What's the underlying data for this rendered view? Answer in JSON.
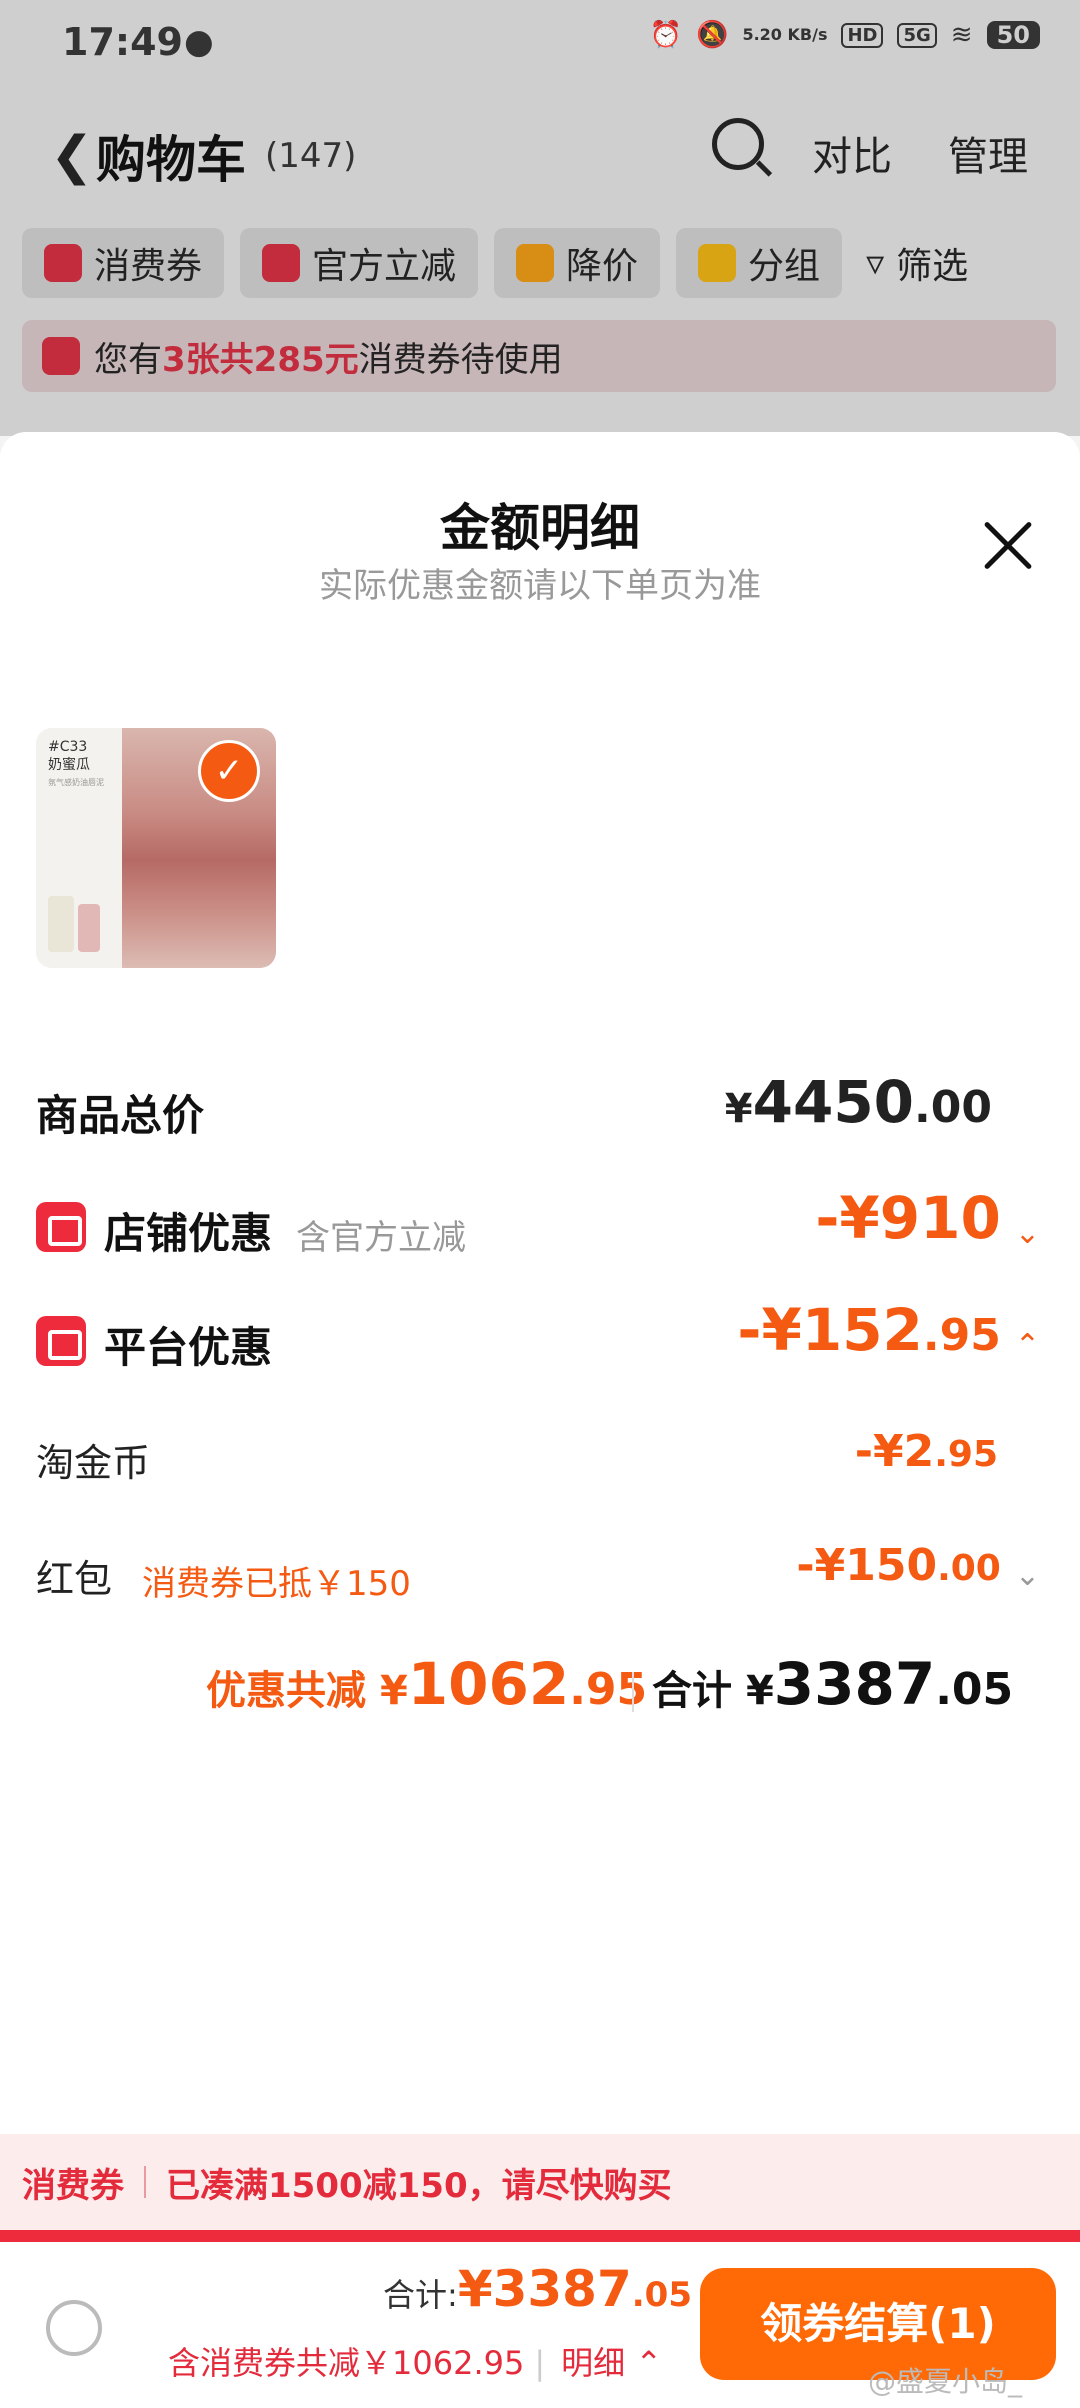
{
  "status_bar": {
    "time": "17:49",
    "net_speed": "5.20\nKB/s",
    "hd": "HD",
    "signal": "5G",
    "battery": "50"
  },
  "header": {
    "title": "购物车",
    "count": "(147)",
    "compare": "对比",
    "manage": "管理"
  },
  "chips": [
    {
      "label": "消费券",
      "color": "#c22c3c"
    },
    {
      "label": "官方立减",
      "color": "#c22c3c"
    },
    {
      "label": "降价",
      "color": "#d88d14"
    },
    {
      "label": "分组",
      "color": "#d8a414"
    },
    {
      "label": "筛选",
      "color": ""
    }
  ],
  "notice": {
    "prefix": "您有",
    "highlight": "3张共285元",
    "suffix": "消费券待使用"
  },
  "sheet": {
    "title": "金额明细",
    "subtitle": "实际优惠金额请以下单页为准",
    "product": {
      "code": "#C33",
      "name": "奶蜜瓜",
      "tagline": "氛气感奶油唇泥",
      "selected": true
    },
    "total_price": {
      "label": "商品总价",
      "symbol": "¥",
      "int": "4450",
      "dec": ".00"
    },
    "shop_discount": {
      "label": "店铺优惠",
      "note": "含官方立减",
      "value": "-¥910"
    },
    "platform_discount": {
      "label": "平台优惠",
      "int": "-¥152",
      "dec": ".95"
    },
    "gold_coin": {
      "label": "淘金币",
      "int": "-¥2",
      "dec": ".95"
    },
    "red_packet": {
      "label": "红包",
      "note": "消费券已抵￥150",
      "int": "-¥150",
      "dec": ".00"
    },
    "summary": {
      "discount_label": "优惠共减",
      "discount_symbol": "¥",
      "discount_int": "1062",
      "discount_dec": ".95",
      "total_label": "合计",
      "total_symbol": "¥",
      "total_int": "3387",
      "total_dec": ".05"
    }
  },
  "promo": {
    "tag": "消费券",
    "text": "已凑满1500减150，请尽快购买"
  },
  "footer": {
    "total_label": "合计:",
    "total_int": "¥3387",
    "total_dec": ".05",
    "sub": "含消费券共减￥1062.95",
    "detail": "明细",
    "pay_button": "领券结算(1)"
  },
  "watermark": "@盛夏小岛_"
}
